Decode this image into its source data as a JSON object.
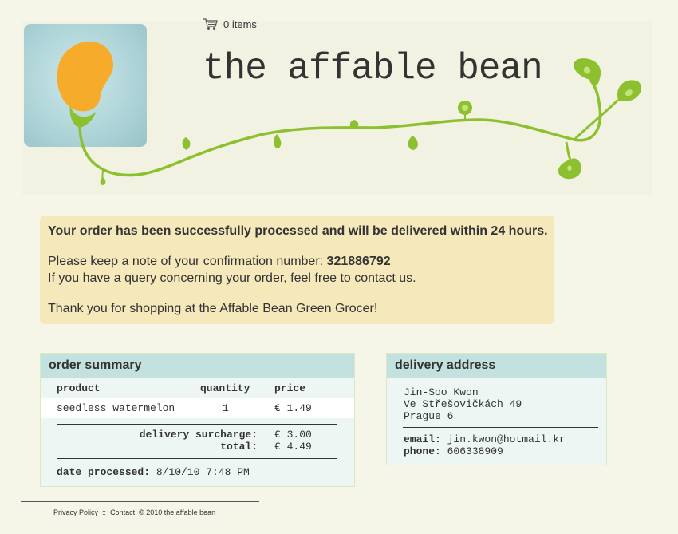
{
  "header": {
    "cart_count": "0 items",
    "brand_title": "the affable bean"
  },
  "confirmation": {
    "headline": "Your order has been successfully processed and will be delivered within 24 hours.",
    "note_prefix": "Please keep a note of your confirmation number:",
    "confirmation_number": "321886792",
    "query_prefix": "If you have a query concerning your order, feel free to",
    "contact_link": "contact us",
    "query_suffix": ".",
    "thanks": "Thank you for shopping at the Affable Bean Green Grocer!"
  },
  "order_summary": {
    "heading": "order summary",
    "columns": [
      "product",
      "quantity",
      "price"
    ],
    "rows": [
      {
        "product": "seedless watermelon",
        "quantity": "1",
        "price": "€ 1.49"
      }
    ],
    "delivery_label": "delivery surcharge:",
    "delivery_value": "€ 3.00",
    "total_label": "total:",
    "total_value": "€ 4.49",
    "date_label": "date processed:",
    "date_value": "8/10/10 7:48 PM"
  },
  "delivery_address": {
    "heading": "delivery address",
    "name": "Jin-Soo Kwon",
    "street": "Ve Střešovičkách 49",
    "city": "Prague 6",
    "email_label": "email:",
    "email_value": "jin.kwon@hotmail.kr",
    "phone_label": "phone:",
    "phone_value": "606338909"
  },
  "footer": {
    "privacy": "Privacy Policy",
    "sep": "::",
    "contact": "Contact",
    "copyright": "©  2010 the affable bean"
  }
}
